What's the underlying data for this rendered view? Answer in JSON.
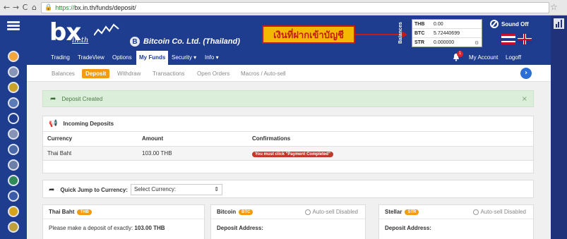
{
  "browser": {
    "url_scheme": "https://",
    "url_rest": "bx.in.th/funds/deposit/",
    "back": "←",
    "forward": "→",
    "reload": "C",
    "home": "⌂",
    "lock": "🔒",
    "star": "☆"
  },
  "header": {
    "logo_text": "bx",
    "logo_sub": "in.th",
    "company_badge": "B",
    "company_name": "Bitcoin Co. Ltd. (Thailand)",
    "annotation": "เงินที่ฝากเข้าบัญชี",
    "balances_label": "Balances",
    "balances": [
      {
        "currency": "THB",
        "value": "0.00"
      },
      {
        "currency": "BTC",
        "value": "5.72440699"
      },
      {
        "currency": "STR",
        "value": "0.000000"
      }
    ],
    "sound_label": "Sound Off",
    "colors": {
      "brand": "#1f3d8e",
      "accent": "#f39c12",
      "annotation_bg": "#f5b800",
      "annotation_border": "#c51a1a"
    }
  },
  "main_nav": {
    "items": [
      "Trading",
      "TradeView",
      "Options",
      "My Funds",
      "Security ▾",
      "Info ▾"
    ],
    "active": "My Funds",
    "notification_count": "1",
    "account": "My Account",
    "logoff": "Logoff"
  },
  "sub_nav": {
    "items": [
      "Balances",
      "Deposit",
      "Withdraw",
      "Transactions",
      "Open Orders",
      "Macros / Auto-sell"
    ],
    "active": "Deposit",
    "next_icon": "›"
  },
  "alert": {
    "text": "Deposit Created",
    "close": "×"
  },
  "incoming": {
    "title": "Incoming Deposits",
    "columns": [
      "Currency",
      "Amount",
      "Confirmations"
    ],
    "rows": [
      {
        "currency": "Thai Baht",
        "amount": "103.00 THB",
        "confirmations": "You must click \"Payment Completed\""
      }
    ]
  },
  "jump": {
    "label": "Quick Jump to Currency:",
    "select_value": "Select Currency:"
  },
  "coins": [
    {
      "name": "Thai Baht",
      "tag": "THB",
      "autosell": "",
      "body_label": "Please make a deposit of exactly:",
      "body_value": "103.00 THB"
    },
    {
      "name": "Bitcoin",
      "tag": "BTC",
      "autosell": "Auto-sell Disabled",
      "body_label": "Deposit Address:",
      "body_value": ""
    },
    {
      "name": "Stellar",
      "tag": "STR",
      "autosell": "Auto-sell Disabled",
      "body_label": "Deposit Address:",
      "body_value": ""
    }
  ]
}
